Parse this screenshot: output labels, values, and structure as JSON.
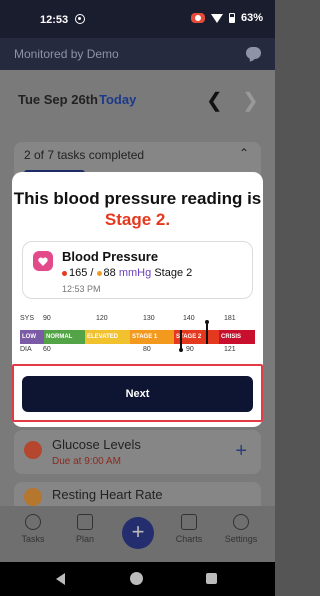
{
  "status_bar": {
    "time": "12:53",
    "battery": "63%"
  },
  "header": {
    "title": "Monitored by Demo"
  },
  "date_nav": {
    "date": "Tue Sep 26th",
    "today_label": "Today"
  },
  "tasks": {
    "summary": "2 of 7 tasks completed",
    "progress_fraction": 0.29,
    "items": [
      {
        "name": "Glucose Levels",
        "due": "Due at 9:00 AM"
      },
      {
        "name": "Resting Heart Rate",
        "due": ""
      }
    ]
  },
  "modal": {
    "headline": "This blood pressure reading is",
    "stage": "Stage 2.",
    "card": {
      "title": "Blood Pressure",
      "systolic": "165",
      "separator": "/",
      "diastolic": "88",
      "unit": "mmHg",
      "stage": "Stage 2",
      "time": "12:53 PM"
    },
    "scale": {
      "sys_label": "SYS",
      "dia_label": "DIA",
      "sys_ticks": [
        "90",
        "120",
        "130",
        "140",
        "181"
      ],
      "dia_ticks": [
        "60",
        "80",
        "90",
        "121"
      ],
      "categories": [
        {
          "label": "LOW",
          "color": "#7b5aa6"
        },
        {
          "label": "NORMAL",
          "color": "#52a447"
        },
        {
          "label": "ELEVATED",
          "color": "#f2c12e"
        },
        {
          "label": "STAGE 1",
          "color": "#f39a1e"
        },
        {
          "label": "STAGE 2",
          "color": "#e5391f"
        },
        {
          "label": "CRISIS",
          "color": "#c8102e"
        }
      ]
    },
    "next_label": "Next"
  },
  "bottom_nav": {
    "tasks": "Tasks",
    "plan": "Plan",
    "add": "+",
    "charts": "Charts",
    "settings": "Settings"
  },
  "colors": {
    "stage2": "#e5391f",
    "primary": "#0d1533",
    "highlight": "#e43a46"
  }
}
